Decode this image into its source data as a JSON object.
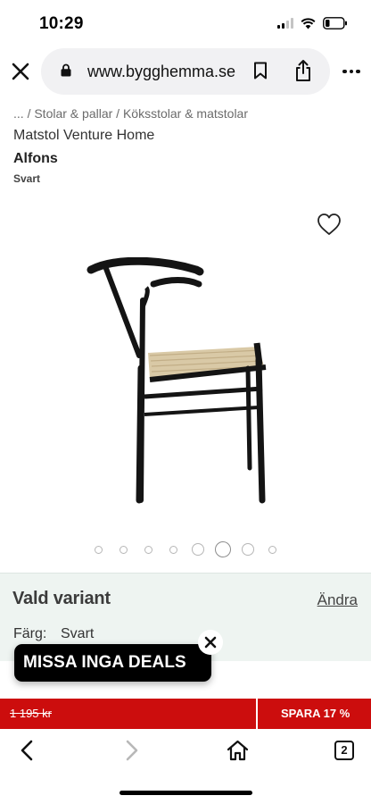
{
  "status_bar": {
    "time": "10:29",
    "icons": [
      "cellular-signal-icon",
      "wifi-icon",
      "battery-icon"
    ]
  },
  "browser": {
    "url": "www.bygghemma.se",
    "open_tabs_count": "2",
    "icons": [
      "close-icon",
      "lock-icon",
      "bookmark-icon",
      "share-icon",
      "more-icon",
      "back-icon",
      "forward-icon",
      "home-icon",
      "tabs-icon"
    ]
  },
  "product": {
    "breadcrumb": {
      "ellipsis": "...",
      "separator": "/",
      "items": [
        "Stolar & pallar",
        "Köksstolar & matstolar"
      ]
    },
    "brand": "Matstol Venture Home",
    "name": "Alfons",
    "color": "Svart",
    "image_slides": {
      "count": 8,
      "active_index": 5
    }
  },
  "variant": {
    "title": "Vald variant",
    "change_label": "Ändra",
    "color_label": "Färg:",
    "color_value": "Svart"
  },
  "deals_banner": {
    "text": "MISSA INGA DEALS"
  },
  "price_bar": {
    "old_price": "1 195 kr",
    "save_label": "SPARA 17 %",
    "color": "#cc0d0d"
  }
}
